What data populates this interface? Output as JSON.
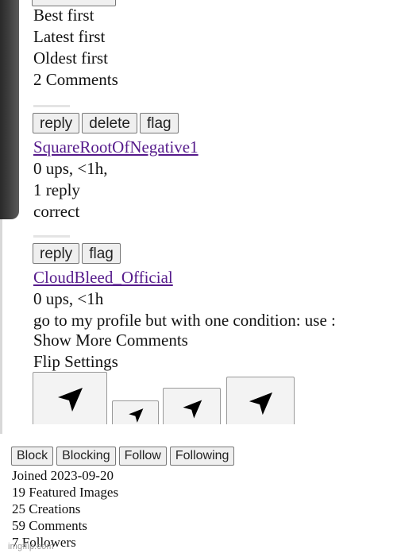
{
  "sort_options": [
    "Best first",
    "Latest first",
    "Oldest first"
  ],
  "comments_count": "2 Comments",
  "comments": [
    {
      "buttons": [
        "reply",
        "delete",
        "flag"
      ],
      "username": "SquareRootOfNegative1",
      "meta": "0 ups, <1h,",
      "replies": "1 reply",
      "text": "correct"
    },
    {
      "buttons": [
        "reply",
        "flag"
      ],
      "username": "CloudBleed_Official",
      "meta": "0 ups, <1h",
      "text": "go to my profile but with one condition: use :"
    }
  ],
  "show_more": "Show More Comments",
  "flip_settings": "Flip Settings",
  "arrow_icon": "cursor-arrow-icon",
  "profile": {
    "buttons": [
      "Block",
      "Blocking",
      "Follow",
      "Following"
    ],
    "joined": "Joined 2023-09-20",
    "featured": "19 Featured Images",
    "creations": "25 Creations",
    "comments": "59 Comments",
    "followers": "7 Followers"
  },
  "watermark": "imgflip.com"
}
